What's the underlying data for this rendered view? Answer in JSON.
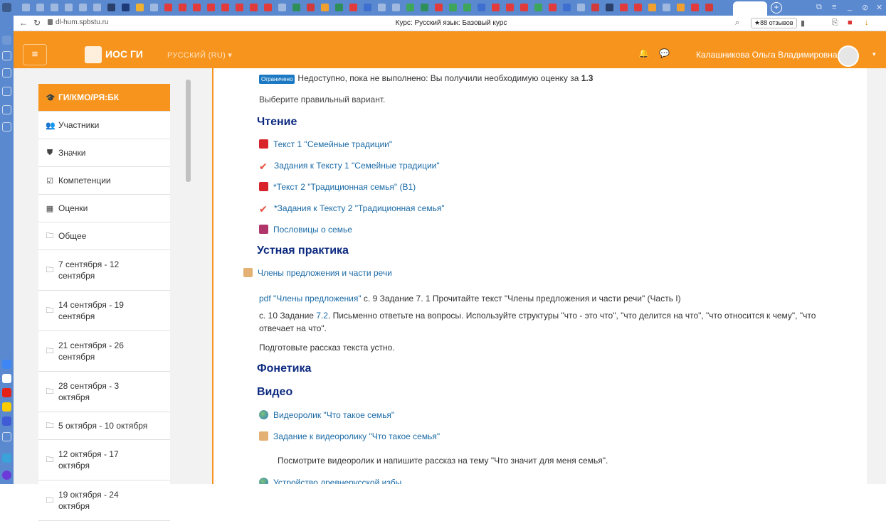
{
  "browser": {
    "url": "dl-hum.spbstu.ru",
    "page_title": "Курс: Русский язык: Базовый курс",
    "reviews_label": "★88 отзывов",
    "tab_add": "+"
  },
  "navbar": {
    "menu_icon": "≡",
    "site_name": "ИОС ГИ",
    "language": "РУССКИЙ (RU) ▾",
    "user_name": "Калашникова Ольга Владимировна",
    "bell_icon": "🔔",
    "chat_icon": "💬",
    "caret": "▾"
  },
  "sidebar": {
    "items": [
      {
        "label": "ГИ/КМО/РЯ:БК",
        "icon": "graduation-cap-icon",
        "glyph": "🎓"
      },
      {
        "label": "Участники",
        "icon": "users-icon",
        "glyph": "👥"
      },
      {
        "label": "Значки",
        "icon": "shield-icon",
        "glyph": "⛊"
      },
      {
        "label": "Компетенции",
        "icon": "checkbox-icon",
        "glyph": "☑"
      },
      {
        "label": "Оценки",
        "icon": "table-icon",
        "glyph": "▦"
      },
      {
        "label": "Общее",
        "icon": "folder-icon",
        "glyph": "🗀"
      },
      {
        "label": "7 сентября - 12 сентября",
        "icon": "folder-icon",
        "glyph": "🗀"
      },
      {
        "label": "14 сентября - 19 сентября",
        "icon": "folder-icon",
        "glyph": "🗀"
      },
      {
        "label": "21 сентября - 26 сентября",
        "icon": "folder-icon",
        "glyph": "🗀"
      },
      {
        "label": "28 сентября - 3 октября",
        "icon": "folder-icon",
        "glyph": "🗀"
      },
      {
        "label": "5 октября - 10 октября",
        "icon": "folder-icon",
        "glyph": "🗀"
      },
      {
        "label": "12 октября - 17 октября",
        "icon": "folder-icon",
        "glyph": "🗀"
      },
      {
        "label": "19 октября - 24 октября",
        "icon": "folder-icon",
        "glyph": "🗀"
      }
    ]
  },
  "main": {
    "restriction": {
      "badge": "Ограничено",
      "text": "Недоступно, пока не выполнено: Вы получили необходимую оценку за",
      "grade_item": "1.3"
    },
    "choose_variant": "Выберите правильный вариант.",
    "reading": {
      "heading": "Чтение",
      "items": [
        {
          "label": "Текст 1 \"Семейные традиции\"",
          "icon": "pdf-icon"
        },
        {
          "label": "Задания к Тексту 1 \"Семейные традиции\"",
          "icon": "quiz-check-icon"
        },
        {
          "label": "*Текст 2 \"Традиционная семья\" (В1)",
          "icon": "pdf-icon"
        },
        {
          "label": "*Задания к Тексту 2 \"Традиционная семья\"",
          "icon": "quiz-check-icon"
        },
        {
          "label": "Пословицы о семье",
          "icon": "presentation-icon"
        }
      ]
    },
    "oral": {
      "heading": "Устная практика",
      "item": "Члены предложения и части речи",
      "task1_link": "pdf \"Члены предложения\"",
      "task1_rest": " с. 9 Задание 7. 1 Прочитайте текст \"Члены предложения и части речи\" (Часть I)",
      "task2_pre": " с. 10 Задание ",
      "task2_link": "7.2",
      "task2_rest": ". Письменно ответьте на вопросы. Используйте структуры \"что - это что\", \"что делится на что\", \"что относится к чему\", \"что отвечает на что\".",
      "task3": "Подготовьте рассказ текста устно."
    },
    "phonetics": {
      "heading": "Фонетика"
    },
    "video": {
      "heading": "Видео",
      "items": [
        {
          "label": "Видеоролик \"Что такое семья\"",
          "icon": "globe-icon"
        },
        {
          "label": "Задание к видеоролику \"Что такое семья\"",
          "icon": "assignment-icon"
        }
      ],
      "instruction": "Посмотрите видеоролик и напишите рассказ на тему \"Что значит для меня семья\".",
      "cut_item": "Устройство древнерусской избы"
    }
  },
  "colors": {
    "brand_orange": "#f7941d",
    "heading_blue": "#0d2a80",
    "link_blue": "#1a6aa6",
    "browser_blue": "#5a89cf"
  }
}
